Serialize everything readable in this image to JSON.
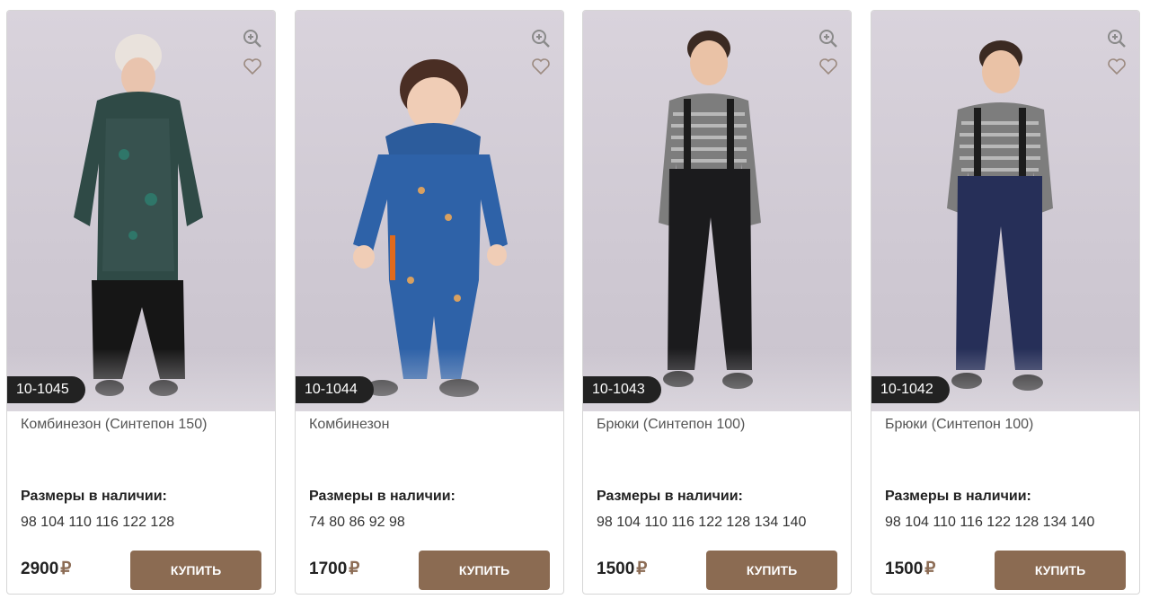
{
  "products": [
    {
      "sku": "10-1045",
      "title": "Комбинезон (Синтепон 150)",
      "sizes_label": "Размеры в наличии:",
      "sizes": "98 104 110 116 122 128",
      "price": "2900",
      "currency": "₽",
      "buy_label": "КУПИТЬ",
      "figure": "overall-green"
    },
    {
      "sku": "10-1044",
      "title": "Комбинезон",
      "sizes_label": "Размеры в наличии:",
      "sizes": "74 80 86 92 98",
      "price": "1700",
      "currency": "₽",
      "buy_label": "КУПИТЬ",
      "figure": "overall-blue"
    },
    {
      "sku": "10-1043",
      "title": "Брюки (Синтепон 100)",
      "sizes_label": "Размеры в наличии:",
      "sizes": "98 104 110 116 122 128 134 140",
      "price": "1500",
      "currency": "₽",
      "buy_label": "КУПИТЬ",
      "figure": "pants-black"
    },
    {
      "sku": "10-1042",
      "title": "Брюки (Синтепон 100)",
      "sizes_label": "Размеры в наличии:",
      "sizes": "98 104 110 116 122 128 134 140",
      "price": "1500",
      "currency": "₽",
      "buy_label": "КУПИТЬ",
      "figure": "pants-navy"
    }
  ],
  "icons": {
    "zoom": "zoom-in-icon",
    "favorite": "heart-icon"
  },
  "colors": {
    "accent": "#8b6b52",
    "sku_badge": "#222222"
  }
}
